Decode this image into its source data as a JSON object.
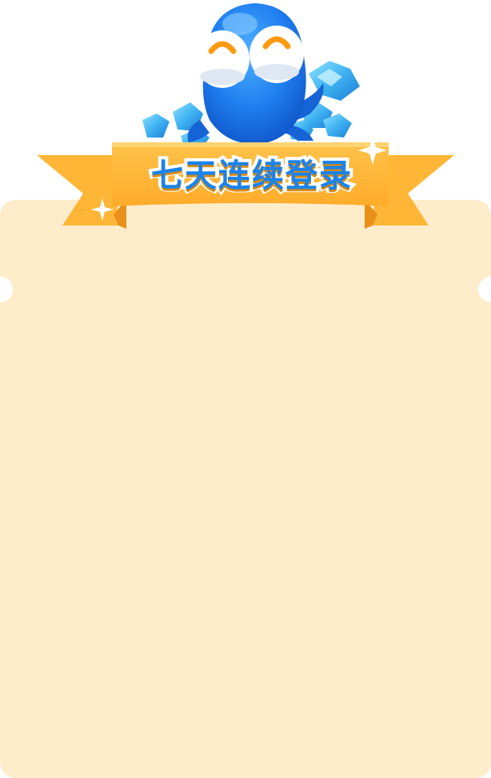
{
  "banner": {
    "title": "七天连续登录"
  },
  "colors": {
    "panel_fill": "#ffeccb",
    "ribbon": "#ffb637",
    "ribbon_dark": "#e8901a",
    "title_text": "#1b83ea",
    "mascot_blue": "#1f7ff0",
    "gem_blue": "#3fb2f2"
  },
  "decorations": {
    "mascot": "blue-octopus-mascot",
    "gems": "blue-diamond-gems",
    "sparkles": "sparkle-stars"
  }
}
